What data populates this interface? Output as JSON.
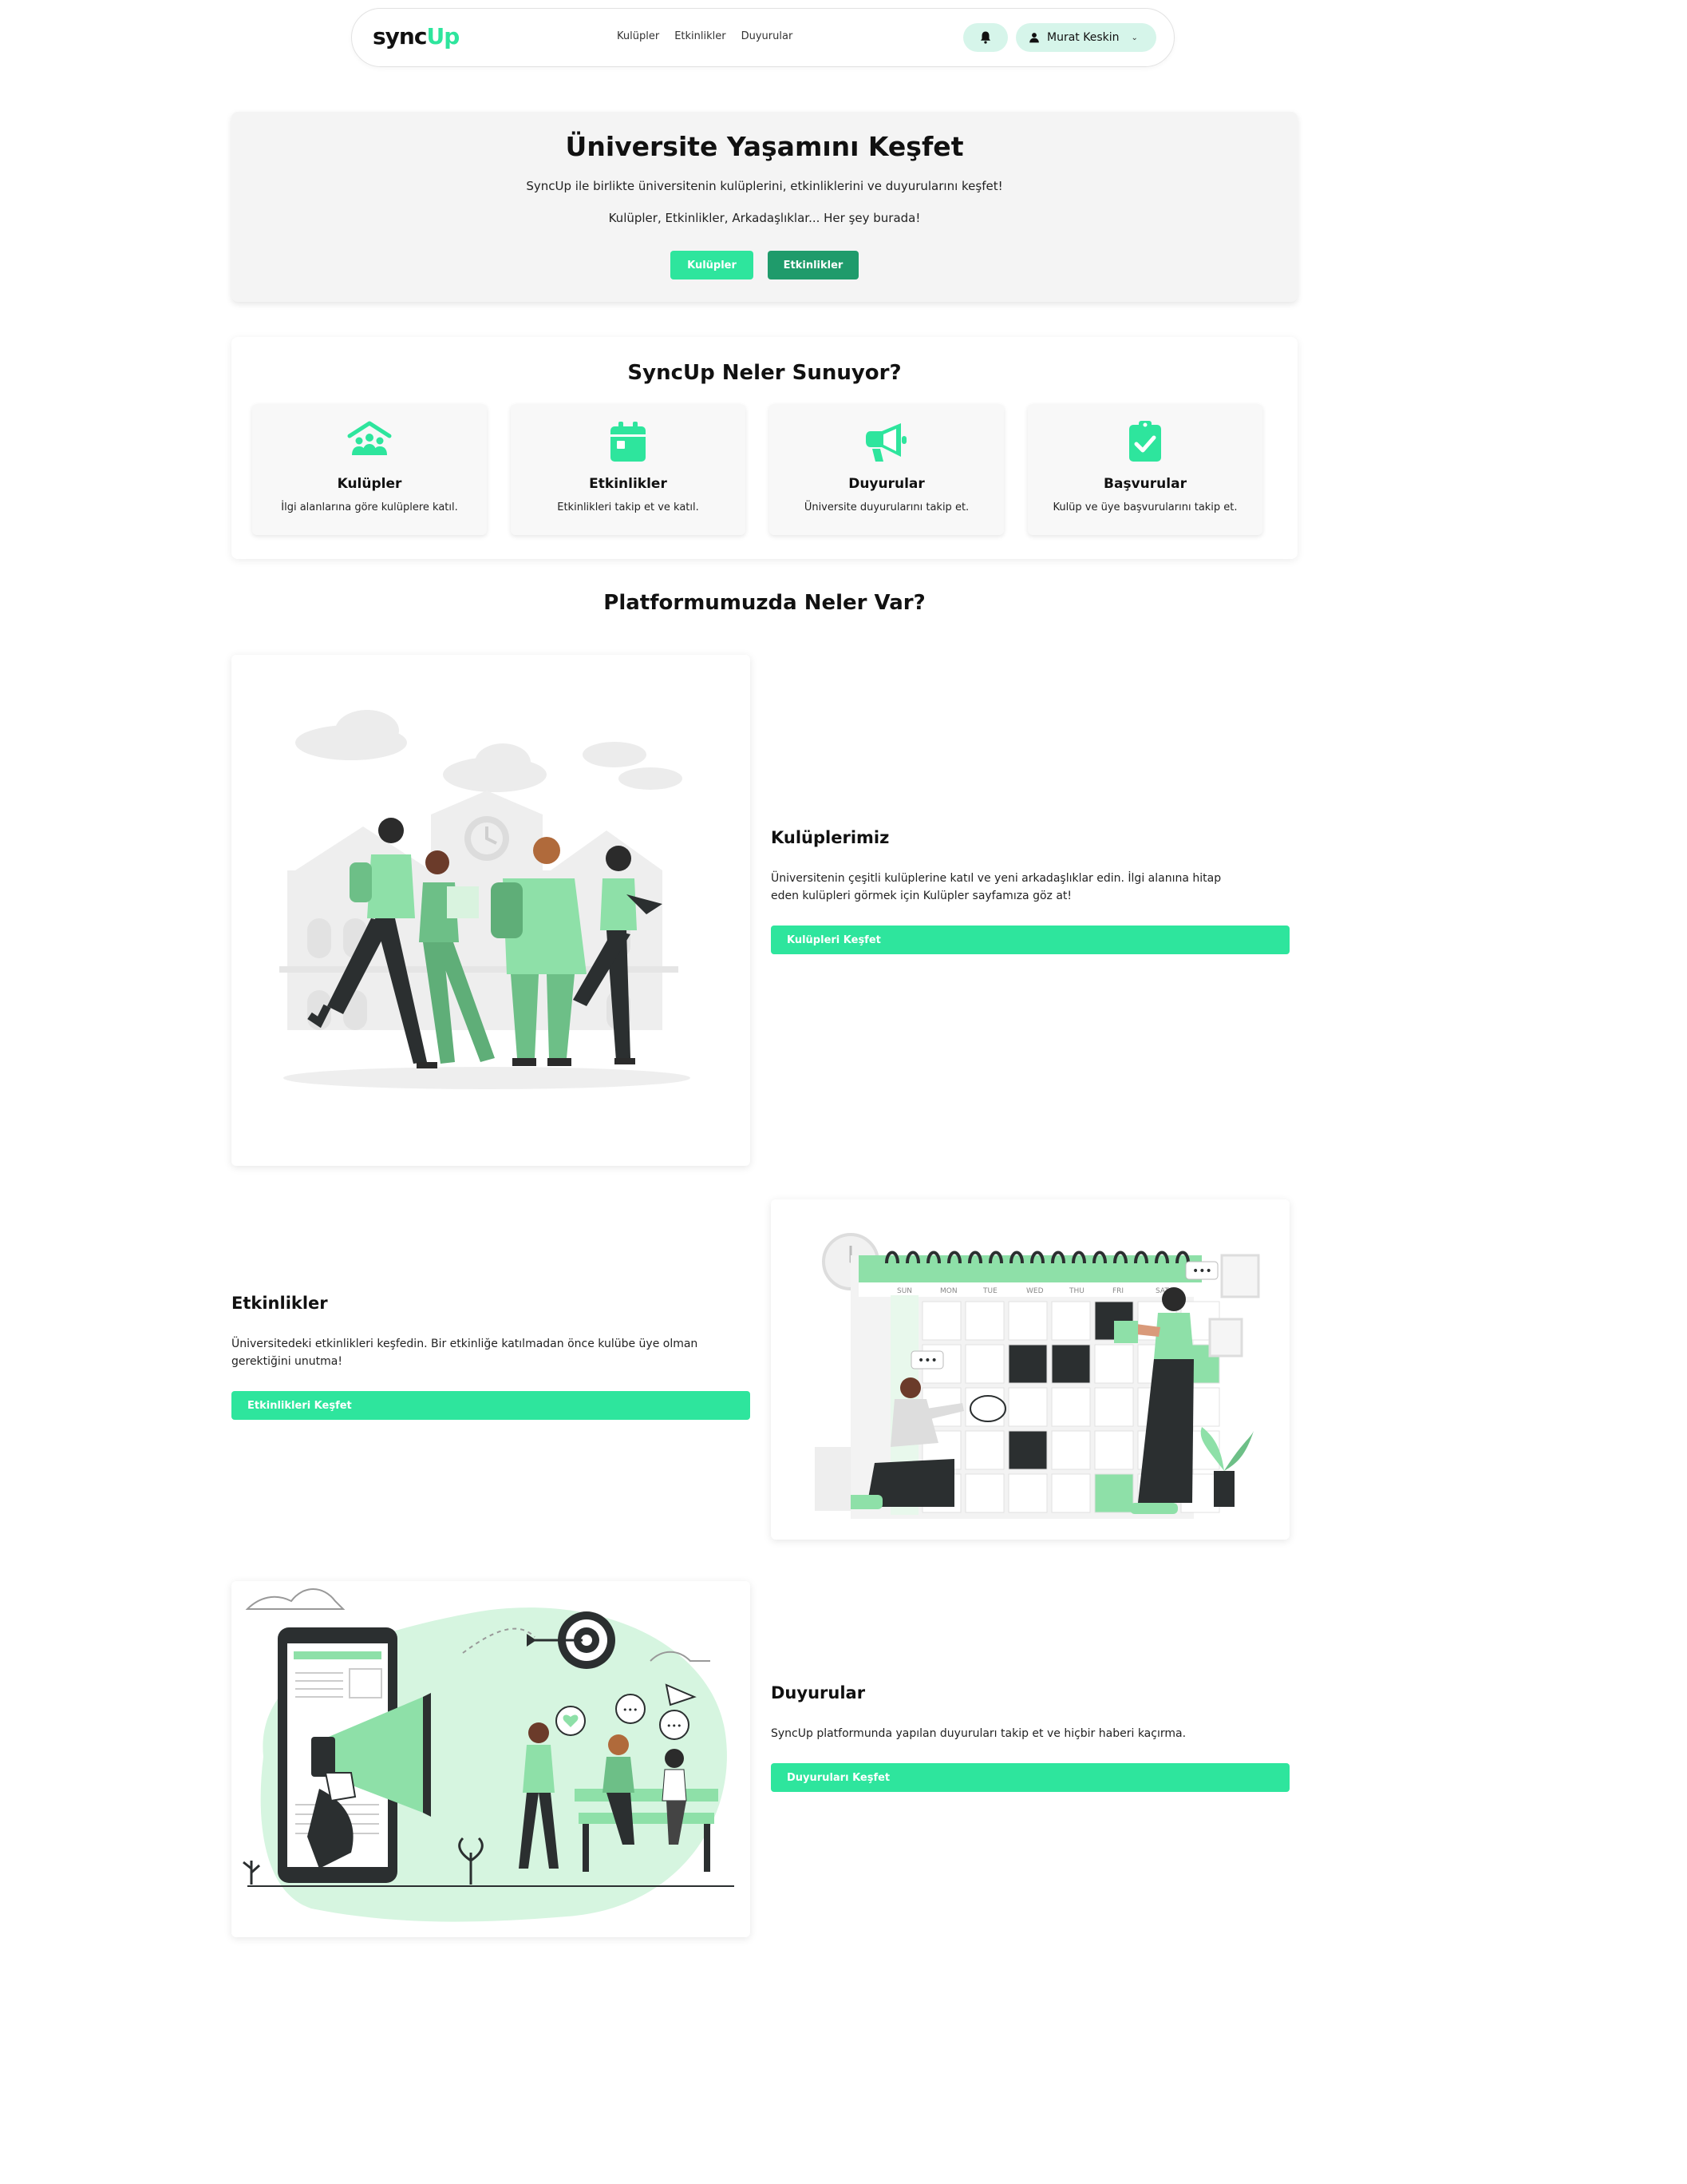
{
  "navbar": {
    "logo_part1": "sync",
    "logo_part2": "Up",
    "links": [
      "Kulüpler",
      "Etkinlikler",
      "Duyurular"
    ],
    "user_name": "Murat Keskin",
    "icons": {
      "bell": "bell-icon",
      "user": "user-icon",
      "chevron": "chevron-down-icon"
    }
  },
  "hero": {
    "title": "Üniversite Yaşamını Keşfet",
    "subtitle1": "SyncUp ile birlikte üniversitenin kulüplerini, etkinliklerini ve duyurularını keşfet!",
    "subtitle2": "Kulüpler, Etkinlikler, Arkadaşlıklar... Her şey burada!",
    "btn_clubs": "Kulüpler",
    "btn_events": "Etkinlikler"
  },
  "features": {
    "title": "SyncUp Neler Sunuyor?",
    "items": [
      {
        "title": "Kulüpler",
        "desc": "İlgi alanlarına göre kulüplere katıl.",
        "icon": "clubs-icon"
      },
      {
        "title": "Etkinlikler",
        "desc": "Etkinlikleri takip et ve katıl.",
        "icon": "calendar-icon"
      },
      {
        "title": "Duyurular",
        "desc": "Üniversite duyurularını takip et.",
        "icon": "megaphone-icon"
      },
      {
        "title": "Başvurular",
        "desc": "Kulüp ve üye başvurularını takip et.",
        "icon": "clipboard-check-icon"
      }
    ]
  },
  "platform": {
    "title": "Platformumuzda Neler Var?",
    "sections": [
      {
        "title": "Kulüplerimiz",
        "desc": "Üniversitenin çeşitli kulüplerine katıl ve yeni arkadaşlıklar edin. İlgi alanına hitap eden kulüpleri görmek için Kulüpler sayfamıza göz at!",
        "button": "Kulüpleri Keşfet"
      },
      {
        "title": "Etkinlikler",
        "desc": "Üniversitedeki etkinlikleri keşfedin. Bir etkinliğe katılmadan önce kulübe üye olman gerektiğini unutma!",
        "button": "Etkinlikleri Keşfet"
      },
      {
        "title": "Duyurular",
        "desc": "SyncUp platformunda yapılan duyuruları takip et ve hiçbir haberi kaçırma.",
        "button": "Duyuruları Keşfet"
      }
    ],
    "calendar_days": [
      "SUN",
      "MON",
      "TUE",
      "WED",
      "THU",
      "FRI",
      "SAT"
    ]
  },
  "colors": {
    "accent": "#2ee59d",
    "accent_dark": "#1f9b6b",
    "accent_light": "#d6f5ea",
    "illustration_green": "#8ee0a8"
  }
}
